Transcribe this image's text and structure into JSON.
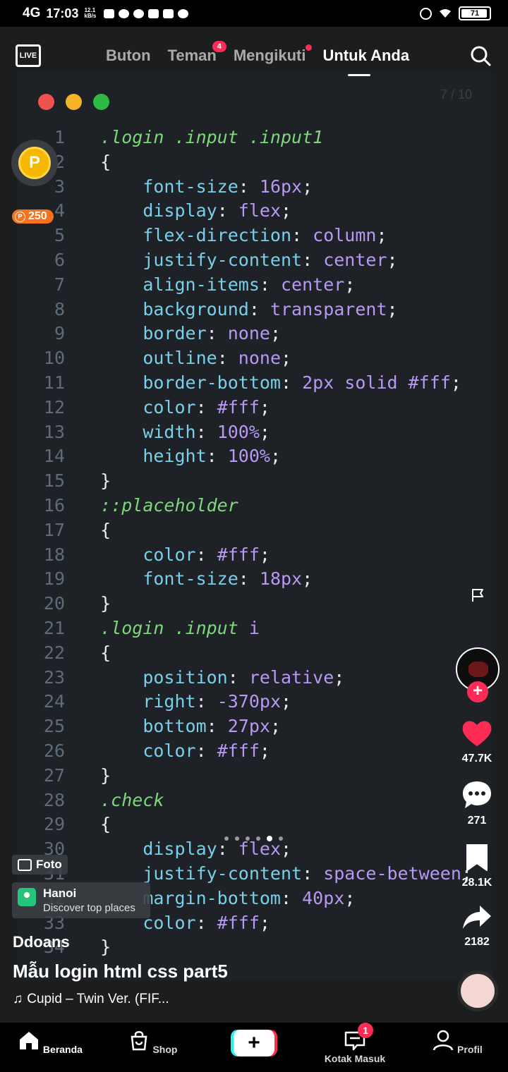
{
  "status_bar": {
    "network": "4G",
    "time": "17:03",
    "speed": "12.1 kB/s",
    "battery": "71"
  },
  "top_nav": {
    "live_label": "LIVE",
    "tabs": [
      {
        "label": "Buton"
      },
      {
        "label": "Teman",
        "badge": "4"
      },
      {
        "label": "Mengikuti"
      },
      {
        "label": "Untuk Anda"
      }
    ]
  },
  "video": {
    "page_counter": "7 / 10",
    "code_lines": [
      {
        "n": "1",
        "parts": [
          [
            "sel",
            ".login .input .input1"
          ]
        ]
      },
      {
        "n": "2",
        "parts": [
          [
            "brace",
            "{"
          ]
        ]
      },
      {
        "n": "3",
        "parts": [
          [
            "prop",
            "    font-size"
          ],
          [
            "punct",
            ": "
          ],
          [
            "num",
            "16px"
          ],
          [
            "punct",
            ";"
          ]
        ]
      },
      {
        "n": "4",
        "parts": [
          [
            "prop",
            "    display"
          ],
          [
            "punct",
            ": "
          ],
          [
            "val",
            "flex"
          ],
          [
            "punct",
            ";"
          ]
        ]
      },
      {
        "n": "5",
        "parts": [
          [
            "prop",
            "    flex-direction"
          ],
          [
            "punct",
            ": "
          ],
          [
            "val",
            "column"
          ],
          [
            "punct",
            ";"
          ]
        ]
      },
      {
        "n": "6",
        "parts": [
          [
            "prop",
            "    justify-content"
          ],
          [
            "punct",
            ": "
          ],
          [
            "val",
            "center"
          ],
          [
            "punct",
            ";"
          ]
        ]
      },
      {
        "n": "7",
        "parts": [
          [
            "prop",
            "    align-items"
          ],
          [
            "punct",
            ": "
          ],
          [
            "val",
            "center"
          ],
          [
            "punct",
            ";"
          ]
        ]
      },
      {
        "n": "8",
        "parts": [
          [
            "prop",
            "    background"
          ],
          [
            "punct",
            ": "
          ],
          [
            "val",
            "transparent"
          ],
          [
            "punct",
            ";"
          ]
        ]
      },
      {
        "n": "9",
        "parts": [
          [
            "prop",
            "    border"
          ],
          [
            "punct",
            ": "
          ],
          [
            "val",
            "none"
          ],
          [
            "punct",
            ";"
          ]
        ]
      },
      {
        "n": "10",
        "parts": [
          [
            "prop",
            "    outline"
          ],
          [
            "punct",
            ": "
          ],
          [
            "val",
            "none"
          ],
          [
            "punct",
            ";"
          ]
        ]
      },
      {
        "n": "11",
        "parts": [
          [
            "prop",
            "    border-bottom"
          ],
          [
            "punct",
            ": "
          ],
          [
            "num",
            "2px"
          ],
          [
            "val",
            " solid #fff"
          ],
          [
            "punct",
            ";"
          ]
        ]
      },
      {
        "n": "12",
        "parts": [
          [
            "prop",
            "    color"
          ],
          [
            "punct",
            ": "
          ],
          [
            "val",
            "#fff"
          ],
          [
            "punct",
            ";"
          ]
        ]
      },
      {
        "n": "13",
        "parts": [
          [
            "prop",
            "    width"
          ],
          [
            "punct",
            ": "
          ],
          [
            "num",
            "100%"
          ],
          [
            "punct",
            ";"
          ]
        ]
      },
      {
        "n": "14",
        "parts": [
          [
            "prop",
            "    height"
          ],
          [
            "punct",
            ": "
          ],
          [
            "num",
            "100%"
          ],
          [
            "punct",
            ";"
          ]
        ]
      },
      {
        "n": "15",
        "parts": [
          [
            "brace",
            "}"
          ]
        ]
      },
      {
        "n": "16",
        "parts": [
          [
            "sel",
            "::placeholder"
          ]
        ]
      },
      {
        "n": "17",
        "parts": [
          [
            "brace",
            "{"
          ]
        ]
      },
      {
        "n": "18",
        "parts": [
          [
            "prop",
            "    color"
          ],
          [
            "punct",
            ": "
          ],
          [
            "val",
            "#fff"
          ],
          [
            "punct",
            ";"
          ]
        ]
      },
      {
        "n": "19",
        "parts": [
          [
            "prop",
            "    font-size"
          ],
          [
            "punct",
            ": "
          ],
          [
            "num",
            "18px"
          ],
          [
            "punct",
            ";"
          ]
        ]
      },
      {
        "n": "20",
        "parts": [
          [
            "brace",
            "}"
          ]
        ]
      },
      {
        "n": "21",
        "parts": [
          [
            "sel",
            ".login .input "
          ],
          [
            "val",
            "i"
          ]
        ]
      },
      {
        "n": "22",
        "parts": [
          [
            "brace",
            "{"
          ]
        ]
      },
      {
        "n": "23",
        "parts": [
          [
            "prop",
            "    position"
          ],
          [
            "punct",
            ": "
          ],
          [
            "val",
            "relative"
          ],
          [
            "punct",
            ";"
          ]
        ]
      },
      {
        "n": "24",
        "parts": [
          [
            "prop",
            "    right"
          ],
          [
            "punct",
            ": "
          ],
          [
            "num",
            "-370px"
          ],
          [
            "punct",
            ";"
          ]
        ]
      },
      {
        "n": "25",
        "parts": [
          [
            "prop",
            "    bottom"
          ],
          [
            "punct",
            ": "
          ],
          [
            "num",
            "27px"
          ],
          [
            "punct",
            ";"
          ]
        ]
      },
      {
        "n": "26",
        "parts": [
          [
            "prop",
            "    color"
          ],
          [
            "punct",
            ": "
          ],
          [
            "val",
            "#fff"
          ],
          [
            "punct",
            ";"
          ]
        ]
      },
      {
        "n": "27",
        "parts": [
          [
            "brace",
            "}"
          ]
        ]
      },
      {
        "n": "28",
        "parts": [
          [
            "sel",
            ".check"
          ]
        ]
      },
      {
        "n": "29",
        "parts": [
          [
            "brace",
            "{"
          ]
        ]
      },
      {
        "n": "30",
        "parts": [
          [
            "prop",
            "    display"
          ],
          [
            "punct",
            ": "
          ],
          [
            "val",
            "flex"
          ],
          [
            "punct",
            ";"
          ]
        ]
      },
      {
        "n": "31",
        "parts": [
          [
            "prop",
            "    justify-content"
          ],
          [
            "punct",
            ": "
          ],
          [
            "val",
            "space-between"
          ],
          [
            "punct",
            ";"
          ]
        ]
      },
      {
        "n": "32",
        "parts": [
          [
            "prop",
            "    margin-bottom"
          ],
          [
            "punct",
            ": "
          ],
          [
            "num",
            "40px"
          ],
          [
            "punct",
            ";"
          ]
        ]
      },
      {
        "n": "33",
        "parts": [
          [
            "prop",
            "    color"
          ],
          [
            "punct",
            ": "
          ],
          [
            "val",
            "#fff"
          ],
          [
            "punct",
            ";"
          ]
        ]
      },
      {
        "n": "34",
        "parts": [
          [
            "brace",
            "}"
          ]
        ]
      }
    ]
  },
  "coin": {
    "symbol": "P",
    "amount": "250"
  },
  "actions": {
    "likes": "47.7K",
    "comments": "271",
    "saves": "28.1K",
    "shares": "2182"
  },
  "chips": {
    "foto": "Foto",
    "location_title": "Hanoi",
    "location_sub": "Discover top places"
  },
  "post": {
    "author": "Ddoans",
    "caption": "Mẫu login html css part5",
    "music": "Cupid – Twin Ver. (FIF..."
  },
  "bottom_nav": {
    "home": "Beranda",
    "shop": "Shop",
    "create": "+",
    "inbox": "Kotak Masuk",
    "inbox_badge": "1",
    "profile": "Profil"
  },
  "colors": {
    "accent": "#fe2c55",
    "selector": "#7dd87a",
    "property": "#79cfe8",
    "value": "#b798f2"
  }
}
